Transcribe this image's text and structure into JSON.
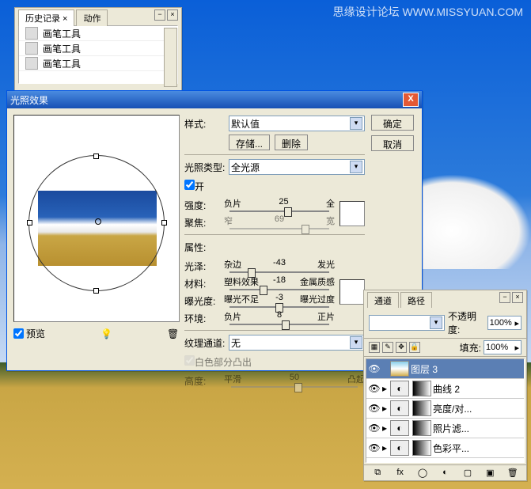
{
  "watermark": "思缘设计论坛  WWW.MISSYUAN.COM",
  "history": {
    "tabs": [
      "历史记录 ×",
      "动作"
    ],
    "items": [
      "画笔工具",
      "画笔工具",
      "画笔工具"
    ]
  },
  "dialog": {
    "title": "光照效果",
    "ok": "确定",
    "cancel": "取消",
    "style_label": "样式:",
    "style_value": "默认值",
    "save": "存储...",
    "delete": "删除",
    "type_label": "光照类型:",
    "type_value": "全光源",
    "on_label": "开",
    "sliders": {
      "intensity": {
        "label": "强度:",
        "left": "负片",
        "val": "25",
        "right": "全",
        "pos": 55
      },
      "focus": {
        "label": "聚焦:",
        "left": "窄",
        "val": "69",
        "right": "宽",
        "pos": 72
      },
      "props": "属性:",
      "gloss": {
        "label": "光泽:",
        "left": "杂边",
        "val": "-43",
        "right": "发光",
        "pos": 18
      },
      "material": {
        "label": "材料:",
        "left": "塑料效果",
        "val": "-18",
        "right": "金属质感",
        "pos": 30
      },
      "exposure": {
        "label": "曝光度:",
        "left": "曝光不足",
        "val": "-3",
        "right": "曝光过度",
        "pos": 46
      },
      "ambience": {
        "label": "环境:",
        "left": "负片",
        "val": "8",
        "right": "正片",
        "pos": 52
      }
    },
    "tex_label": "纹理通道:",
    "tex_value": "无",
    "white_high": "白色部分凸出",
    "height": {
      "label": "高度:",
      "left": "平滑",
      "val": "50",
      "right": "凸起",
      "pos": 50
    },
    "preview_label": "预览"
  },
  "layers": {
    "tabs": [
      "通道",
      "路径"
    ],
    "opacity_label": "不透明度:",
    "opacity_val": "100%",
    "fill_label": "填充:",
    "fill_val": "100%",
    "items": [
      {
        "name": "图层 3",
        "sel": true,
        "mask": false,
        "icon": ""
      },
      {
        "name": "曲线 2",
        "sel": false,
        "mask": true,
        "icon": "◐"
      },
      {
        "name": "亮度/对...",
        "sel": false,
        "mask": true,
        "icon": "◐"
      },
      {
        "name": "照片滤...",
        "sel": false,
        "mask": true,
        "icon": "◐"
      },
      {
        "name": "色彩平...",
        "sel": false,
        "mask": true,
        "icon": "◐"
      }
    ]
  },
  "chevron": "▾"
}
